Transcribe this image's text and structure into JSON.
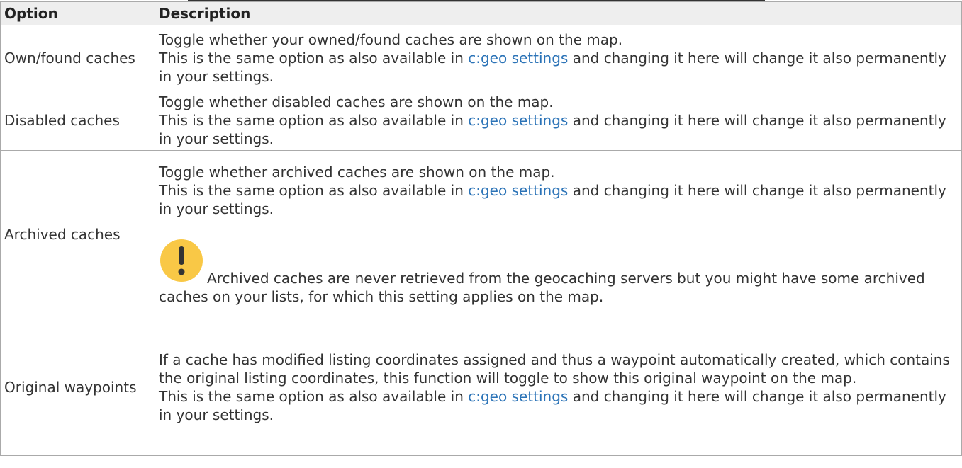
{
  "table": {
    "headers": {
      "option": "Option",
      "description": "Description"
    },
    "link_text": "c:geo settings",
    "rows": [
      {
        "option": "Own/found caches",
        "line1": "Toggle whether your owned/found caches are shown on the map.",
        "same_pre": "This is the same option as also available in",
        "same_post": "and changing it here will change it also permanently in your settings."
      },
      {
        "option": "Disabled caches",
        "line1": "Toggle whether disabled caches are shown on the map.",
        "same_pre": "This is the same option as also available in",
        "same_post": "and changing it here will change it also permanently in your settings."
      },
      {
        "option": "Archived caches",
        "line1": "Toggle whether archived caches are shown on the map.",
        "same_pre": "This is the same option as also available in",
        "same_post": "and changing it here will change it also permanently in your settings.",
        "note": "Archived caches are never retrieved from the geocaching servers but you might have some archived caches on your lists, for which this setting applies on the map.",
        "note_icon": "warning-icon"
      },
      {
        "option": "Original waypoints",
        "line1": "If a cache has modified listing coordinates assigned and thus a waypoint automatically created, which contains the original listing coordinates, this function will toggle to show this original waypoint on the map.",
        "same_pre": "This is the same option as also available in",
        "same_post": "and changing it here will change it also permanently in your settings."
      }
    ]
  },
  "colors": {
    "link": "#2b73b7",
    "header_bg": "#eeeeee",
    "border": "#aaaaaa",
    "warning": "#f9c846"
  }
}
